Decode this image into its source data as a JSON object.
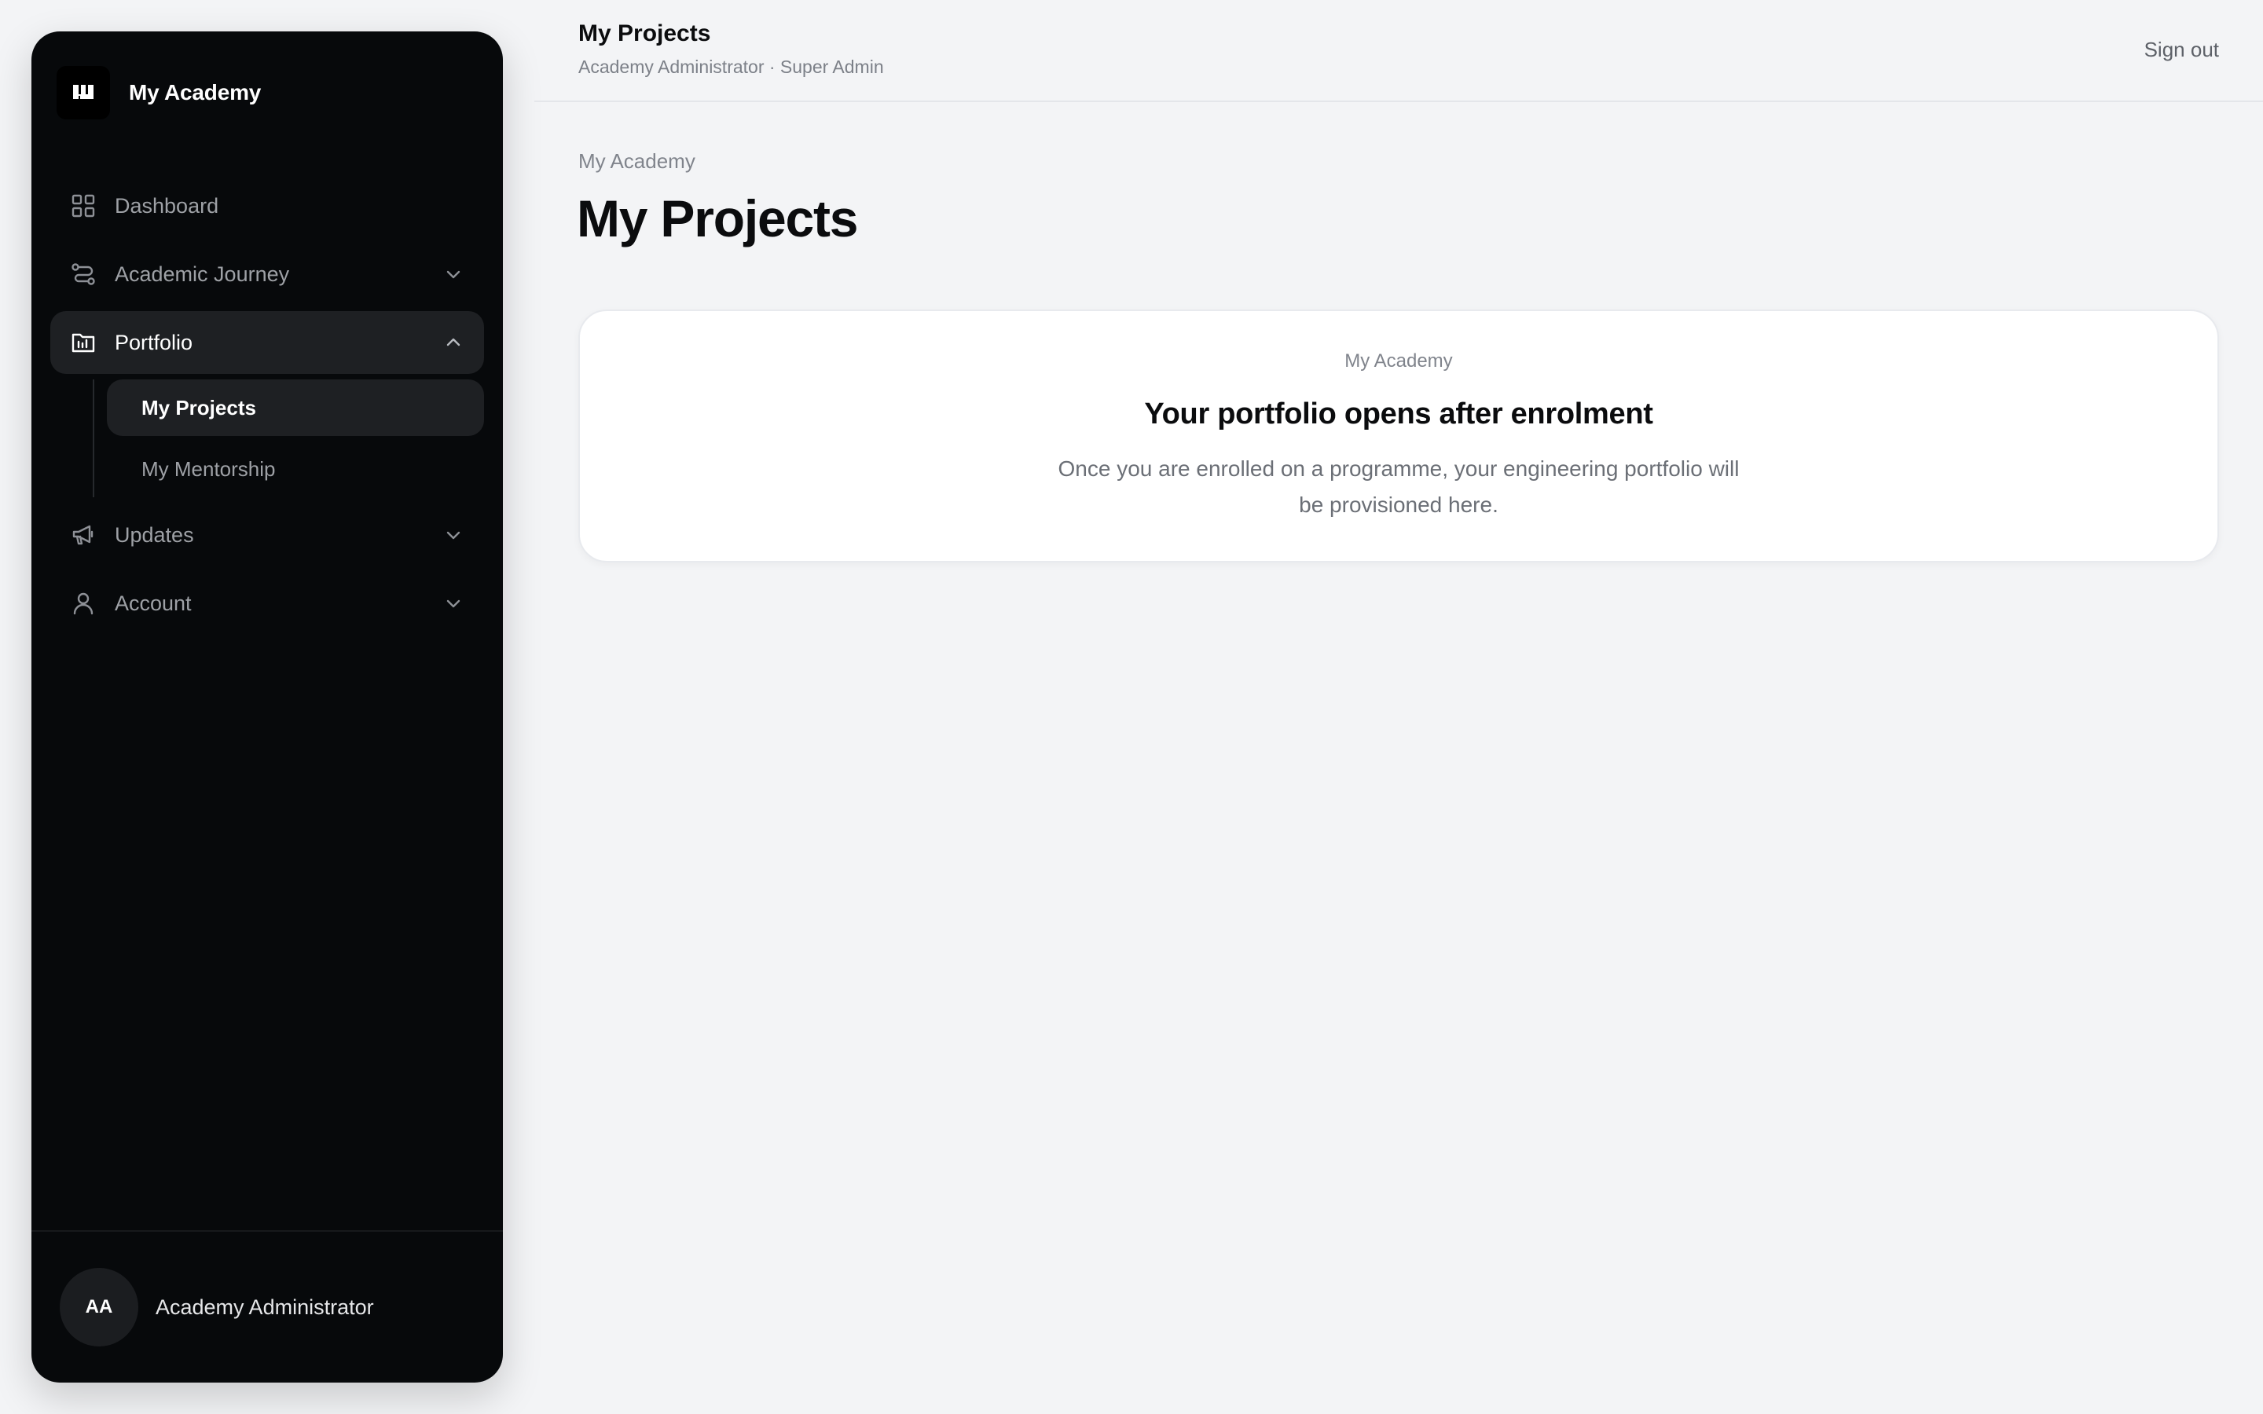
{
  "app": {
    "brand_name": "My Academy"
  },
  "sidebar": {
    "items": [
      {
        "label": "Dashboard",
        "icon": "grid-icon",
        "expandable": false
      },
      {
        "label": "Academic Journey",
        "icon": "route-icon",
        "expandable": true,
        "expanded": false
      },
      {
        "label": "Portfolio",
        "icon": "folder-chart-icon",
        "expandable": true,
        "expanded": true,
        "active": true
      },
      {
        "label": "Updates",
        "icon": "megaphone-icon",
        "expandable": true,
        "expanded": false
      },
      {
        "label": "Account",
        "icon": "user-icon",
        "expandable": true,
        "expanded": false
      }
    ],
    "portfolio_children": [
      {
        "label": "My Projects",
        "active": true
      },
      {
        "label": "My Mentorship",
        "active": false
      }
    ],
    "footer": {
      "initials": "AA",
      "user_name": "Academy Administrator"
    }
  },
  "topbar": {
    "title": "My Projects",
    "subtitle": "Academy Administrator · Super Admin",
    "sign_out_label": "Sign out"
  },
  "main": {
    "breadcrumb": "My Academy",
    "page_title": "My Projects",
    "empty_state": {
      "eyebrow": "My Academy",
      "title": "Your portfolio opens after enrolment",
      "body": "Once you are enrolled on a programme, your engineering portfolio will be provisioned here."
    }
  },
  "colors": {
    "sidebar_bg": "#07090b",
    "sidebar_active_bg": "#1e2023",
    "page_bg": "#f3f4f6",
    "card_bg": "#ffffff"
  }
}
